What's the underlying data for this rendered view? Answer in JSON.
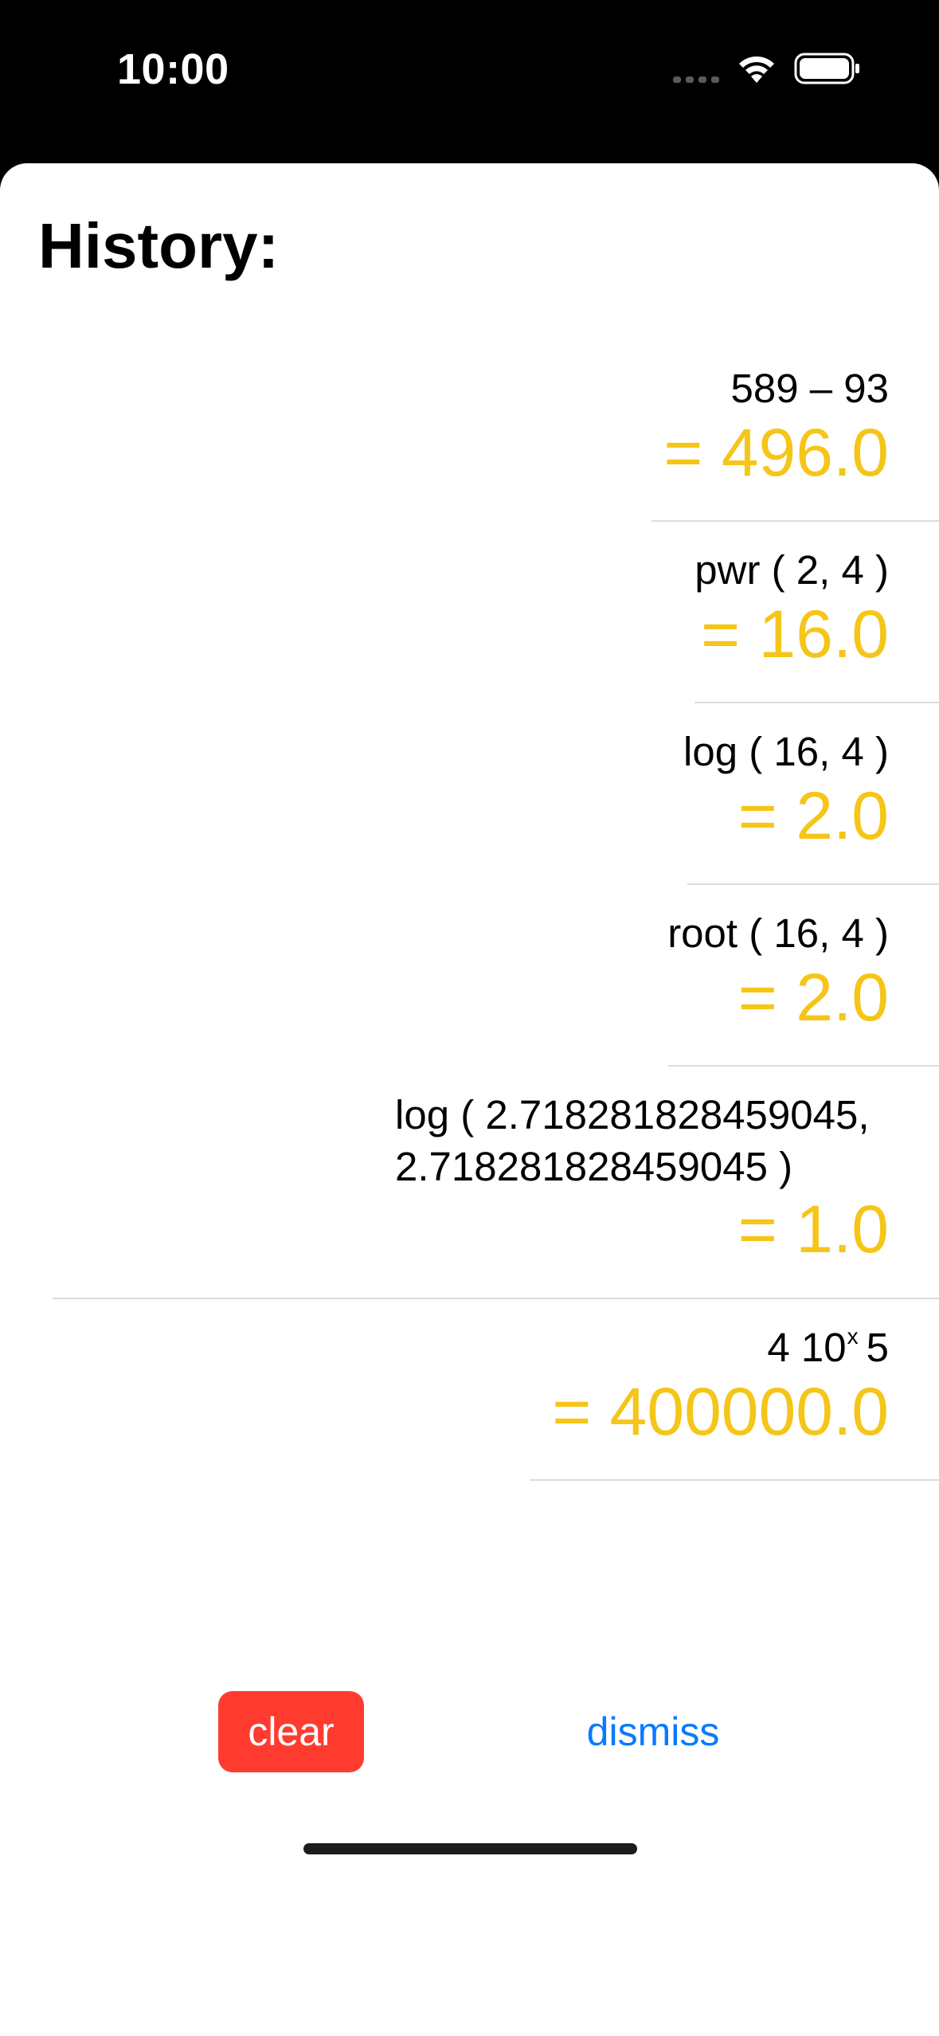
{
  "status_bar": {
    "time": "10:00",
    "icons": [
      "cellular-signal-icon",
      "wifi-icon",
      "battery-icon"
    ]
  },
  "sheet": {
    "title": "History:"
  },
  "history": [
    {
      "expression": "589 – 93",
      "result": "= 496.0"
    },
    {
      "expression": "pwr ( 2, 4 )",
      "result": "= 16.0"
    },
    {
      "expression": "log ( 16, 4 )",
      "result": "= 2.0"
    },
    {
      "expression": "root ( 16, 4 )",
      "result": "= 2.0"
    },
    {
      "expression_line1": "log ( 2.718281828459045,",
      "expression_line2": "2.718281828459045 )",
      "result": "= 1.0"
    },
    {
      "expression_base": "4 10",
      "expression_sup": "x",
      "expression_rest": "5",
      "result": "= 400000.0"
    }
  ],
  "buttons": {
    "clear_label": "clear",
    "dismiss_label": "dismiss"
  },
  "colors": {
    "result": "#f5c518",
    "clear_button": "#ff3b30",
    "dismiss_link": "#0a7aff",
    "separator": "#dcdcdf"
  }
}
